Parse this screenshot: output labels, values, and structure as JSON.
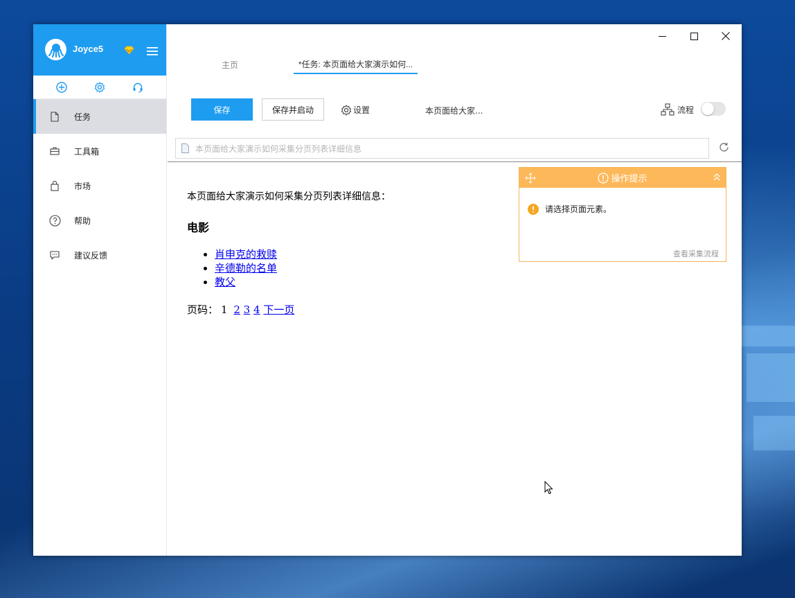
{
  "user": {
    "name": "Joyce5"
  },
  "sidebar": {
    "items": [
      {
        "label": "任务",
        "icon": "file-icon",
        "active": true
      },
      {
        "label": "工具箱",
        "icon": "toolbox-icon",
        "active": false
      },
      {
        "label": "市场",
        "icon": "shopping-bag-icon",
        "active": false
      },
      {
        "label": "帮助",
        "icon": "help-circle-icon",
        "active": false
      },
      {
        "label": "建议反馈",
        "icon": "feedback-icon",
        "active": false
      }
    ]
  },
  "tabs": [
    {
      "label": "主页",
      "active": false
    },
    {
      "label": "*任务: 本页面给大家演示如何...",
      "active": true
    }
  ],
  "toolbar": {
    "save_label": "保存",
    "save_start_label": "保存并启动",
    "settings_label": "设置",
    "task_name": "本页面给大家...",
    "flow_label": "流程",
    "flow_enabled": false
  },
  "urlbar": {
    "value": "本页面给大家演示如何采集分页列表详细信息"
  },
  "webpage": {
    "intro": "本页面给大家演示如何采集分页列表详细信息：",
    "heading": "电影",
    "movies": [
      "肖申克的救赎",
      "辛德勒的名单",
      "教父"
    ],
    "pager_label": "页码：",
    "pager_current": "1",
    "pager_links": [
      "2",
      "3",
      "4"
    ],
    "next_label": "下一页"
  },
  "tip": {
    "title": "操作提示",
    "message": "请选择页面元素。",
    "link": "查看采集流程"
  },
  "colors": {
    "accent": "#1e9cf0",
    "tip_header": "#fdb85a",
    "tip_warning": "#f5a623",
    "link": "#0000ee"
  }
}
